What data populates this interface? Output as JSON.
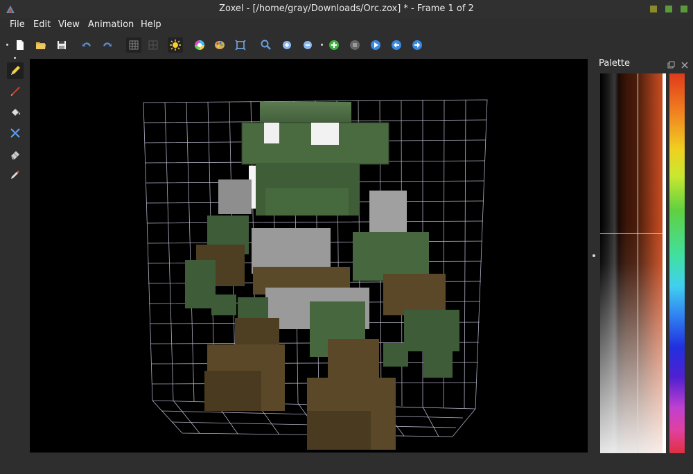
{
  "window": {
    "title": "Zoxel - [/home/gray/Downloads/Orc.zox] * - Frame 1 of 2",
    "btn_colors": [
      "#8a8a2a",
      "#5a9a3a",
      "#5a9a3a"
    ]
  },
  "menu": {
    "items": [
      "File",
      "Edit",
      "View",
      "Animation",
      "Help"
    ]
  },
  "toolbar": {
    "icons": [
      "new-file-icon",
      "open-folder-icon",
      "save-icon",
      "undo-icon",
      "redo-icon",
      "grid-icon",
      "grid-alt-icon",
      "light-icon",
      "color-wheel-icon",
      "palette-icon",
      "fit-view-icon",
      "zoom-icon",
      "zoom-in-icon",
      "zoom-out-icon",
      "add-frame-icon",
      "stop-icon",
      "play-icon",
      "prev-frame-icon",
      "next-frame-icon"
    ]
  },
  "tools": {
    "icons": [
      "pencil-icon",
      "line-icon",
      "fill-icon",
      "move-icon",
      "eraser-icon",
      "color-picker-icon"
    ],
    "selected": "pencil-icon"
  },
  "palette": {
    "title": "Palette"
  },
  "colors": {
    "voxel_green": "#4a6a40",
    "voxel_grey": "#9a9a9a",
    "voxel_white": "#f0f0f0",
    "voxel_brown": "#5a4a28",
    "grid_line": "#ddddff"
  }
}
